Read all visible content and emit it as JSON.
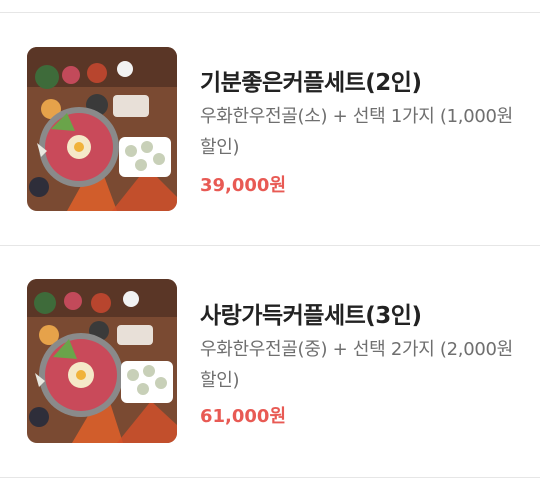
{
  "colors": {
    "accent_price": "#e85a54",
    "title": "#222222",
    "description": "#6f6f6f",
    "divider": "#e6e6e6"
  },
  "menu_items": [
    {
      "title": "기분좋은커플세트(2인)",
      "description": "우화한우전골(소) + 선택 1가지 (1,000원 할인)",
      "price": "39,000원",
      "image": "food-photo"
    },
    {
      "title": "사랑가득커플세트(3인)",
      "description": "우화한우전골(중) + 선택 2가지 (2,000원 할인)",
      "price": "61,000원",
      "image": "food-photo"
    }
  ]
}
